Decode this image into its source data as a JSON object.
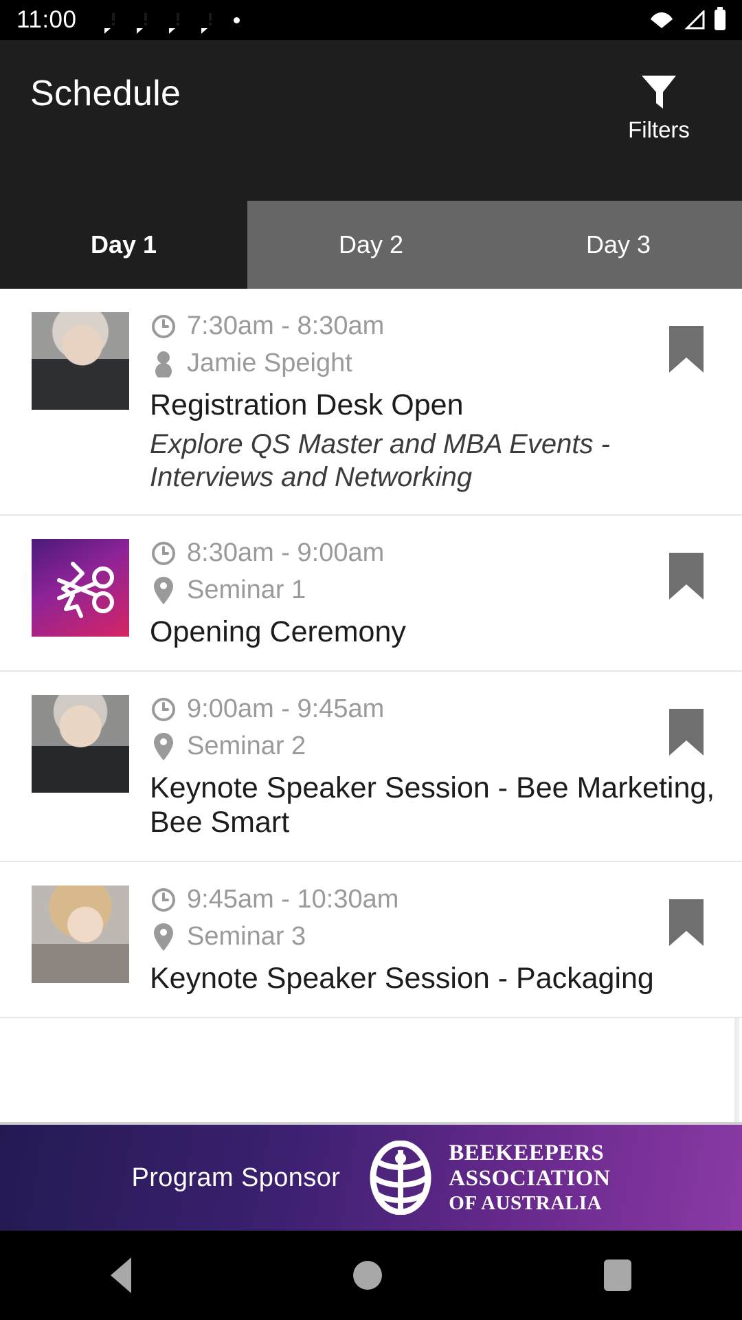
{
  "status_bar": {
    "time": "11:00",
    "notification_icons": [
      "chat-alert-icon",
      "chat-alert-icon",
      "chat-alert-icon",
      "chat-alert-icon",
      "dot-icon"
    ],
    "right_icons": [
      "wifi-icon",
      "cell-signal-icon",
      "battery-icon"
    ]
  },
  "app_bar": {
    "title": "Schedule",
    "filters_label": "Filters",
    "filters_icon": "funnel-icon"
  },
  "tabs": {
    "active_index": 0,
    "items": [
      {
        "label": "Day 1"
      },
      {
        "label": "Day 2"
      },
      {
        "label": "Day 3"
      }
    ]
  },
  "colors": {
    "app_bar_bg": "#1e1e1e",
    "tab_inactive_bg": "#666666",
    "meta_text": "#9a9a9a",
    "title_text": "#1c1c1c",
    "bookmark": "#6f6f6f",
    "sponsor_gradient_start": "#241a52",
    "sponsor_gradient_end": "#8a3aa4",
    "thumb_gradient_start": "#4b1a7a",
    "thumb_gradient_end": "#d62565"
  },
  "schedule": {
    "events": [
      {
        "time": "7:30am - 8:30am",
        "time_icon": "clock-icon",
        "meta2_icon": "person-icon",
        "meta2": "Jamie Speight",
        "title": "Registration Desk Open",
        "description": "Explore QS Master and MBA Events - Interviews and Networking",
        "thumb_type": "photo-man-1",
        "bookmark_icon": "bookmark-icon"
      },
      {
        "time": "8:30am - 9:00am",
        "time_icon": "clock-icon",
        "meta2_icon": "location-pin-icon",
        "meta2": "Seminar 1",
        "title": "Opening Ceremony",
        "description": "",
        "thumb_type": "gradient-scissors",
        "bookmark_icon": "bookmark-icon"
      },
      {
        "time": "9:00am - 9:45am",
        "time_icon": "clock-icon",
        "meta2_icon": "location-pin-icon",
        "meta2": "Seminar 2",
        "title": "Keynote Speaker Session - Bee Marketing, Bee Smart",
        "description": "",
        "thumb_type": "photo-man-2",
        "bookmark_icon": "bookmark-icon"
      },
      {
        "time": "9:45am - 10:30am",
        "time_icon": "clock-icon",
        "meta2_icon": "location-pin-icon",
        "meta2": "Seminar 3",
        "title": "Keynote Speaker Session - Packaging",
        "description": "",
        "thumb_type": "photo-woman",
        "bookmark_icon": "bookmark-icon"
      }
    ]
  },
  "sponsor": {
    "label": "Program Sponsor",
    "logo_icon": "beehive-globe-icon",
    "name_line1": "BEEKEEPERS",
    "name_line2": "ASSOCIATION",
    "name_line3": "OF AUSTRALIA"
  },
  "nav_bar": {
    "back": "back-icon",
    "home": "home-icon",
    "recents": "recents-icon"
  }
}
